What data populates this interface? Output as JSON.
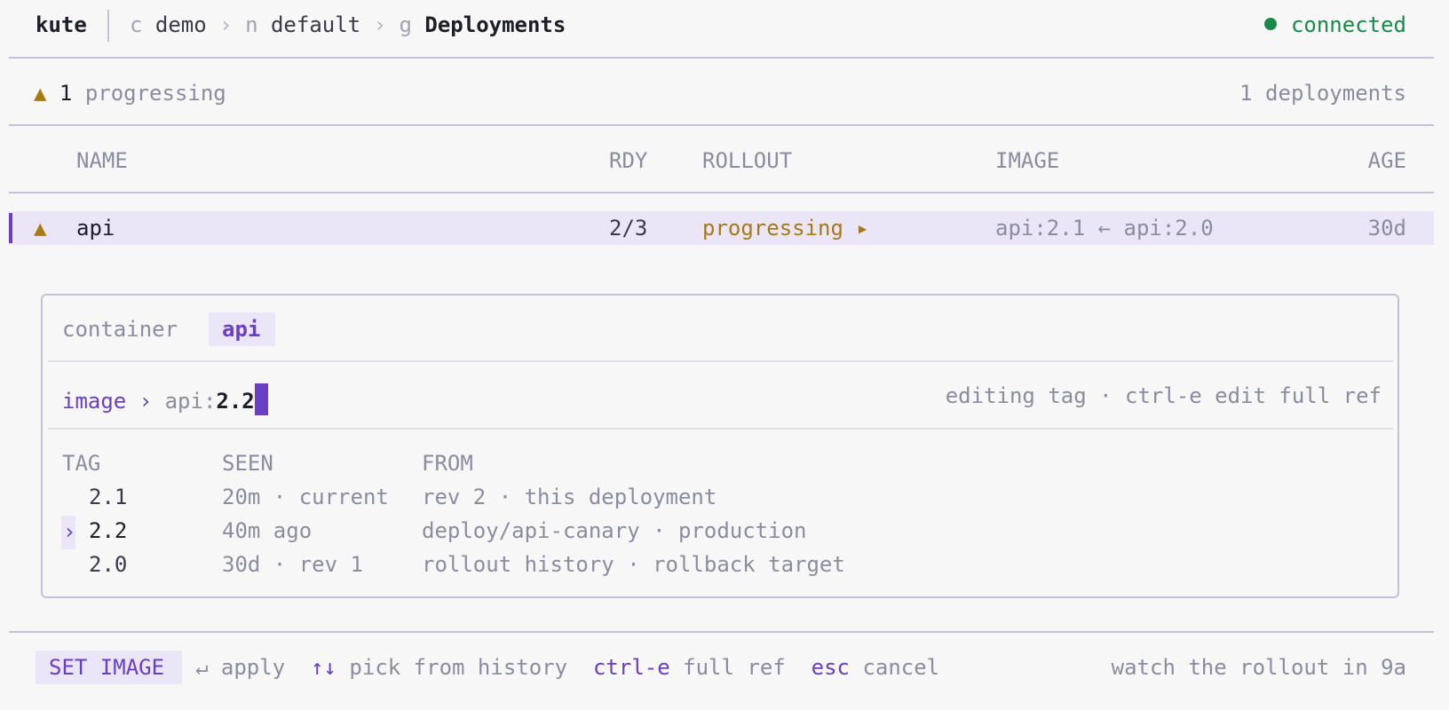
{
  "app": {
    "name": "kute"
  },
  "breadcrumb": [
    {
      "letter": "c",
      "value": "demo"
    },
    {
      "letter": "n",
      "value": "default"
    },
    {
      "letter": "g",
      "value": "Deployments"
    }
  ],
  "breadcrumb_separator": "›",
  "connection": {
    "status": "connected",
    "color": "#1a8a4a"
  },
  "summary": {
    "warning_glyph": "▲",
    "count": "1",
    "label": "progressing",
    "total": "1 deployments"
  },
  "table": {
    "columns": [
      "NAME",
      "RDY",
      "ROLLOUT",
      "IMAGE",
      "AGE"
    ],
    "rows": [
      {
        "status_glyph": "▲",
        "name": "api",
        "ready": "2/3",
        "rollout": "progressing ▸",
        "image": "api:2.1 ← api:2.0",
        "age": "30d"
      }
    ]
  },
  "panel": {
    "container_label": "container",
    "container_value": "api",
    "prompt": {
      "label": "image",
      "chevron": "›",
      "prefix": "api:",
      "value": "2.2"
    },
    "hint": "editing tag · ctrl-e edit full ref",
    "history": {
      "columns": [
        "TAG",
        "SEEN",
        "FROM"
      ],
      "selected_marker": "›",
      "rows": [
        {
          "tag": "2.1",
          "seen": "20m · current",
          "from": "rev 2 · this deployment",
          "selected": false
        },
        {
          "tag": "2.2",
          "seen": "40m ago",
          "from": "deploy/api-canary · production",
          "selected": true
        },
        {
          "tag": "2.0",
          "seen": "30d · rev 1",
          "from": "rollout history · rollback target",
          "selected": false
        }
      ]
    }
  },
  "footer": {
    "mode": "SET IMAGE",
    "keys": [
      {
        "key": "↵",
        "action": "apply"
      },
      {
        "key": "↑↓",
        "action": "pick from history"
      },
      {
        "key": "ctrl-e",
        "action": "full ref"
      },
      {
        "key": "esc",
        "action": "cancel"
      }
    ],
    "tip": "watch the rollout in 9a"
  },
  "colors": {
    "accent": "#6a3fc4",
    "warning": "#a87a14",
    "ok": "#1a8a4a",
    "selection_bg": "#ebe5f8"
  }
}
